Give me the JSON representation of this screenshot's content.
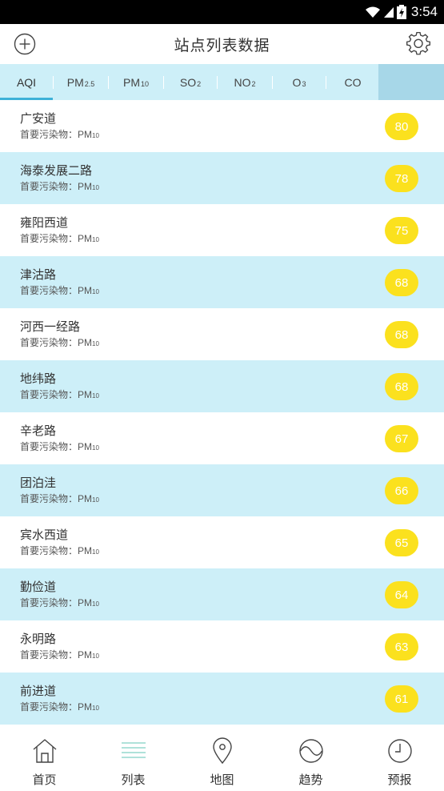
{
  "status_bar": {
    "time": "3:54"
  },
  "header": {
    "title": "站点列表数据"
  },
  "tabs": [
    {
      "label": "AQI",
      "sub": "",
      "active": true
    },
    {
      "label": "PM",
      "sub": "2.5",
      "active": false
    },
    {
      "label": "PM",
      "sub": "10",
      "active": false
    },
    {
      "label": "SO",
      "sub": "2",
      "active": false
    },
    {
      "label": "NO",
      "sub": "2",
      "active": false
    },
    {
      "label": "O",
      "sub": "3",
      "active": false
    },
    {
      "label": "CO",
      "sub": "",
      "active": false
    }
  ],
  "pollutant_prefix": "首要污染物：PM",
  "pollutant_sub": "10",
  "stations": [
    {
      "name": "广安道",
      "value": "80"
    },
    {
      "name": "海泰发展二路",
      "value": "78"
    },
    {
      "name": "雍阳西道",
      "value": "75"
    },
    {
      "name": "津沽路",
      "value": "68"
    },
    {
      "name": "河西一经路",
      "value": "68"
    },
    {
      "name": "地纬路",
      "value": "68"
    },
    {
      "name": "辛老路",
      "value": "67"
    },
    {
      "name": "团泊洼",
      "value": "66"
    },
    {
      "name": "宾水西道",
      "value": "65"
    },
    {
      "name": "勤俭道",
      "value": "64"
    },
    {
      "name": "永明路",
      "value": "63"
    },
    {
      "name": "前进道",
      "value": "61"
    }
  ],
  "nav": [
    {
      "label": "首页",
      "icon": "home-icon"
    },
    {
      "label": "列表",
      "icon": "list-icon"
    },
    {
      "label": "地图",
      "icon": "map-pin-icon"
    },
    {
      "label": "趋势",
      "icon": "trend-icon"
    },
    {
      "label": "预报",
      "icon": "clock-icon"
    }
  ],
  "colors": {
    "accent": "#3eb1d8",
    "row_alt": "#cdeff8",
    "badge": "#fbe11e",
    "list_icon_active": "#7fd1c3"
  }
}
